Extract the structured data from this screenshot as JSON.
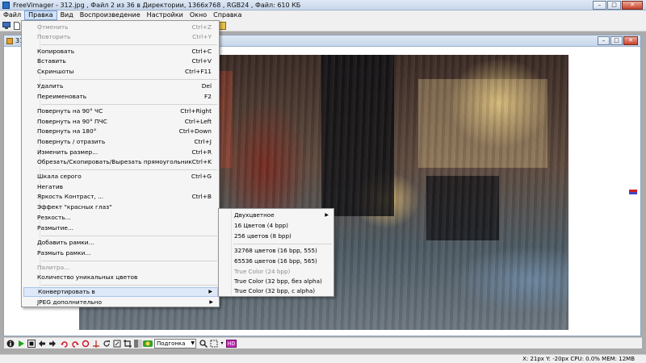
{
  "window": {
    "title": "FreeVimager - 312.jpg , Файл  2 из 36 в Директории, 1366x768 , RGB24 , Файл: 610 КБ",
    "minimize": "–",
    "maximize": "□",
    "close": "✕"
  },
  "menubar": [
    "Файл",
    "Правка",
    "Вид",
    "Воспроизведение",
    "Настройки",
    "Окно",
    "Справка"
  ],
  "child": {
    "title": "31",
    "minimize": "–",
    "maximize": "□",
    "close": "✕"
  },
  "edit_menu": {
    "items": [
      {
        "label": "Отменить",
        "shortcut": "Ctrl+Z",
        "disabled": true
      },
      {
        "label": "Повторить",
        "shortcut": "Ctrl+Y",
        "disabled": true
      },
      {
        "label": "Копировать",
        "shortcut": "Ctrl+C"
      },
      {
        "label": "Вставить",
        "shortcut": "Ctrl+V"
      },
      {
        "label": "Скриншоты",
        "shortcut": "Ctrl+F11"
      },
      {
        "label": "Удалить",
        "shortcut": "Del"
      },
      {
        "label": "Переименовать",
        "shortcut": "F2"
      },
      {
        "label": "Повернуть на  90° ЧС",
        "shortcut": "Ctrl+Right"
      },
      {
        "label": "Повернуть на  90° ПЧС",
        "shortcut": "Ctrl+Left"
      },
      {
        "label": "Повернуть на 180°",
        "shortcut": "Ctrl+Down"
      },
      {
        "label": "Повернуть / отразить",
        "shortcut": "Ctrl+J"
      },
      {
        "label": "Изменить размер...",
        "shortcut": "Ctrl+R"
      },
      {
        "label": "Обрезать/Скопировать/Вырезать прямоугольник",
        "shortcut": "Ctrl+K"
      },
      {
        "label": "Шкала серого",
        "shortcut": "Ctrl+G"
      },
      {
        "label": "Негатив",
        "shortcut": ""
      },
      {
        "label": "Яркость Контраст, ...",
        "shortcut": "Ctrl+B"
      },
      {
        "label": "Эффект \"красных глаз\"",
        "shortcut": ""
      },
      {
        "label": "Резкость...",
        "shortcut": ""
      },
      {
        "label": "Размытие...",
        "shortcut": ""
      },
      {
        "label": "Добавить рамки...",
        "shortcut": ""
      },
      {
        "label": "Размыть рамки...",
        "shortcut": ""
      },
      {
        "label": "Палитра...",
        "shortcut": "",
        "disabled": true
      },
      {
        "label": "Количество уникальных цветов",
        "shortcut": ""
      },
      {
        "label": "Конвертировать в",
        "shortcut": "",
        "submenu": true,
        "highlighted": true
      },
      {
        "label": "JPEG дополнительно",
        "shortcut": "",
        "submenu": true
      }
    ]
  },
  "convert_submenu": {
    "items": [
      {
        "label": "Двухцветное",
        "submenu": true
      },
      {
        "label": "16 Цветов (4 bpp)"
      },
      {
        "label": "256 цветов (8 bpp)"
      },
      {
        "label": "32768 цветов (16 bpp, 555)"
      },
      {
        "label": "65536 цветов (16 bpp, 565)"
      },
      {
        "label": "True Color (24 bpp)",
        "disabled": true
      },
      {
        "label": "True Color (32 bpp, без alpha)"
      },
      {
        "label": "True Color (32 bpp, с alpha)"
      }
    ]
  },
  "bottom_toolbar": {
    "zoom_value": "Подгонка",
    "badge": "HD"
  },
  "status": {
    "text": "X: 21px  Y: -20px  CPU: 0.0%  MEM: 12MB"
  },
  "colors": {
    "accent": "#2b6cc4",
    "menu_highlight": "#dde8f8"
  }
}
